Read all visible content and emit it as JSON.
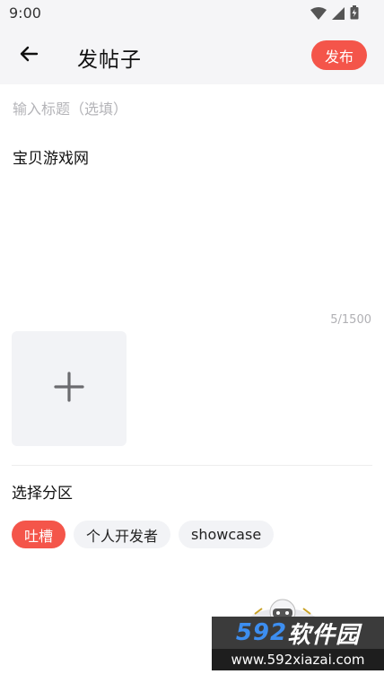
{
  "status_bar": {
    "time": "9:00"
  },
  "header": {
    "title": "发帖子",
    "publish_label": "发布",
    "accent_color": "#f4554a"
  },
  "editor": {
    "title_placeholder": "输入标题（选填）",
    "title_value": "",
    "body_text": "宝贝游戏网",
    "char_count": "5/1500"
  },
  "section": {
    "label": "选择分区",
    "chips": [
      {
        "label": "吐槽",
        "active": true
      },
      {
        "label": "个人开发者",
        "active": false
      },
      {
        "label": "showcase",
        "active": false
      }
    ]
  },
  "watermark": {
    "brand_num": "592",
    "brand_text": "软件园",
    "url": "www.592xiazai.com"
  },
  "icons": {
    "back": "arrow-left-icon",
    "add": "plus-icon",
    "wifi": "wifi-icon",
    "signal": "signal-icon",
    "battery": "battery-icon"
  }
}
